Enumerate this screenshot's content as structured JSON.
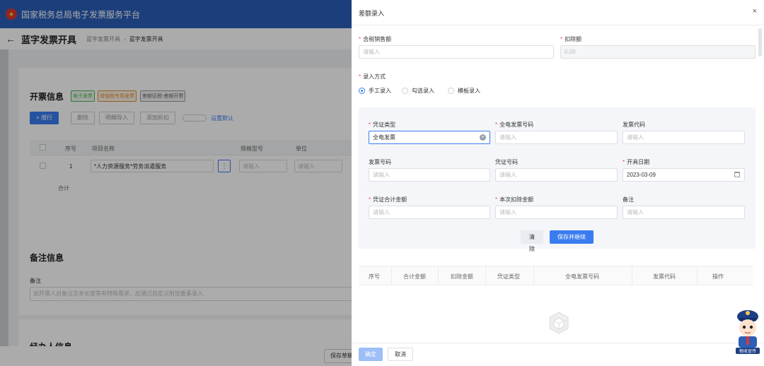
{
  "background": {
    "platform_title": "国家税务总局电子发票服务平台",
    "page_title": "蓝字发票开具",
    "breadcrumbs": [
      "蓝字发票开具",
      "蓝字发票开具"
    ],
    "invoice_section": {
      "title": "开票信息",
      "tags": [
        "电子发票",
        "增值税专用发票",
        "差额征税-差额开票"
      ],
      "buttons": [
        "+ 增行",
        "删除",
        "明细导入",
        "添加折扣",
        "设置默认"
      ],
      "columns": [
        "序号",
        "项目名称",
        "规格型号",
        "单位"
      ],
      "row": {
        "index": "1",
        "name": "*人力资源服务*劳务派遣服务",
        "placeholder": "请输入"
      },
      "total_label": "合计"
    },
    "remark_section": {
      "title": "备注信息",
      "label": "备注",
      "placeholder": "如开票人对备注文本长度等有特殊需求，应通过自定义附加要素录入"
    },
    "agent_section_title": "经办人信息",
    "save_draft": "保存草稿"
  },
  "drawer": {
    "title": "差额录入",
    "close": "×",
    "tax_inclusive_sales": {
      "label": "含税销售额",
      "placeholder": "请输入"
    },
    "deduction": {
      "label": "扣除额",
      "value": "0.00"
    },
    "entry_mode": {
      "label": "录入方式",
      "options": [
        "手工录入",
        "勾选录入",
        "模板录入"
      ],
      "selected": "手工录入"
    },
    "form": {
      "voucher_type": {
        "label": "凭证类型",
        "value": "全电发票"
      },
      "full_invoice_no": {
        "label": "全电发票号码",
        "placeholder": "请输入"
      },
      "invoice_code": {
        "label": "发票代码",
        "placeholder": "请输入"
      },
      "invoice_no": {
        "label": "发票号码",
        "placeholder": "请输入"
      },
      "voucher_no": {
        "label": "凭证号码",
        "placeholder": "请输入"
      },
      "issue_date": {
        "label": "开具日期",
        "value": "2023-03-09"
      },
      "voucher_total": {
        "label": "凭证合计金额",
        "placeholder": "请输入"
      },
      "current_deduction": {
        "label": "本次扣除金额",
        "placeholder": "请输入"
      },
      "remark": {
        "label": "备注",
        "placeholder": "请输入"
      },
      "clear_button": "清除",
      "save_continue_button": "保存并继续"
    },
    "table": {
      "columns": [
        "序号",
        "合计金额",
        "扣除金额",
        "凭证类型",
        "全电发票号码",
        "发票代码",
        "操作"
      ]
    },
    "footer": {
      "confirm": "确定",
      "cancel": "取消"
    }
  },
  "mascot": {
    "caption": "税收宣传"
  },
  "colors": {
    "primary": "#3a7cf0",
    "header": "#2b5fb8",
    "required": "#e34d4d"
  }
}
